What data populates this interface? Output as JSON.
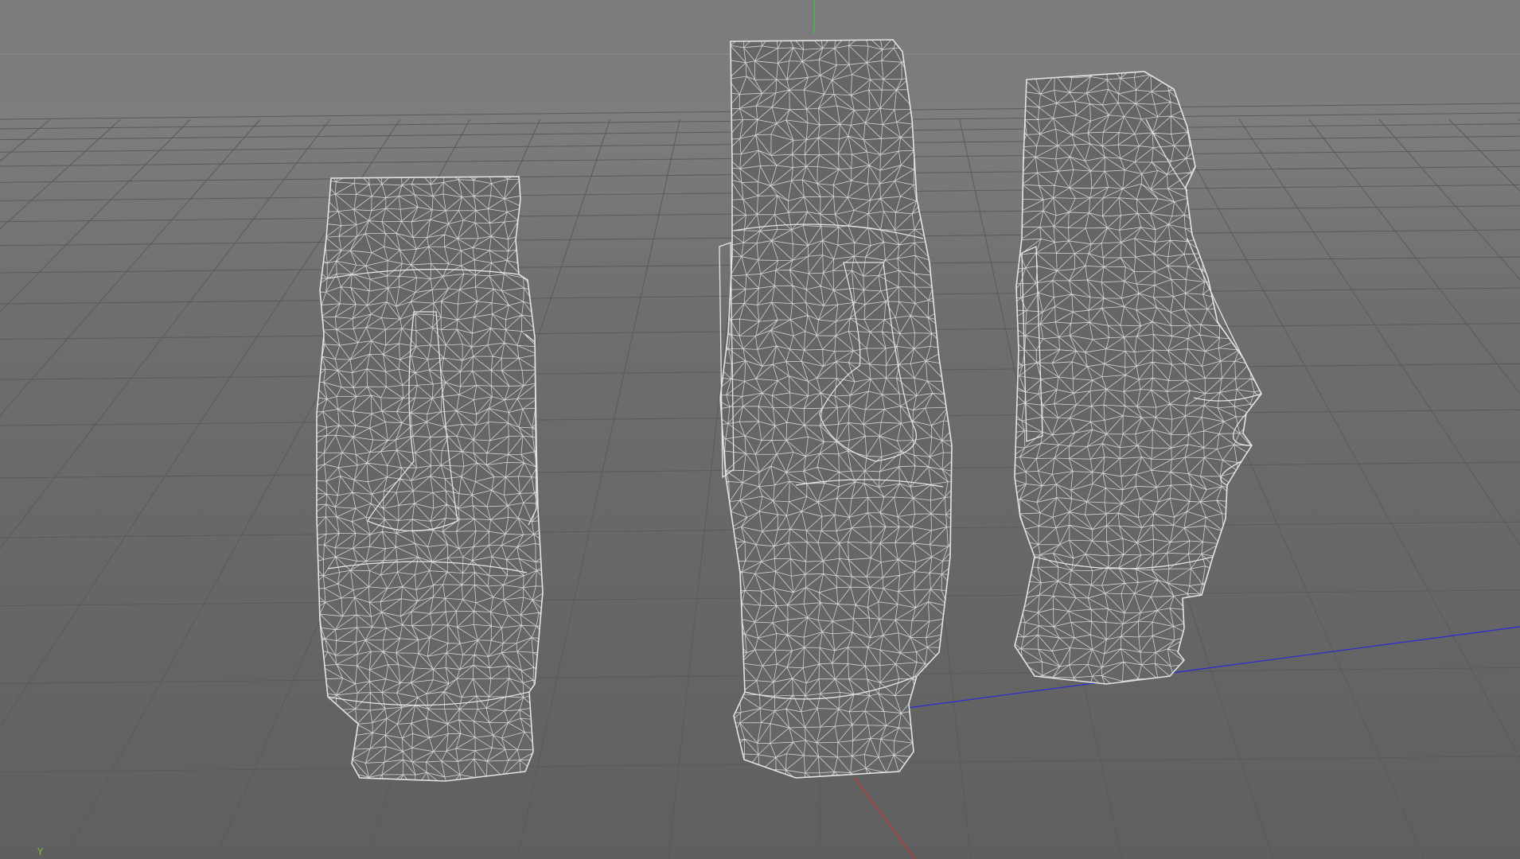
{
  "viewport": {
    "axis_label": "Y",
    "background": "#7b7b7b",
    "grid_color": "#5a5a5a",
    "wire_color": "#e4e4e4",
    "mesh_fill": "#666666",
    "axis_colors": {
      "x": "#d0302a",
      "y": "#3fc43a",
      "z": "#2a2ad6"
    }
  }
}
